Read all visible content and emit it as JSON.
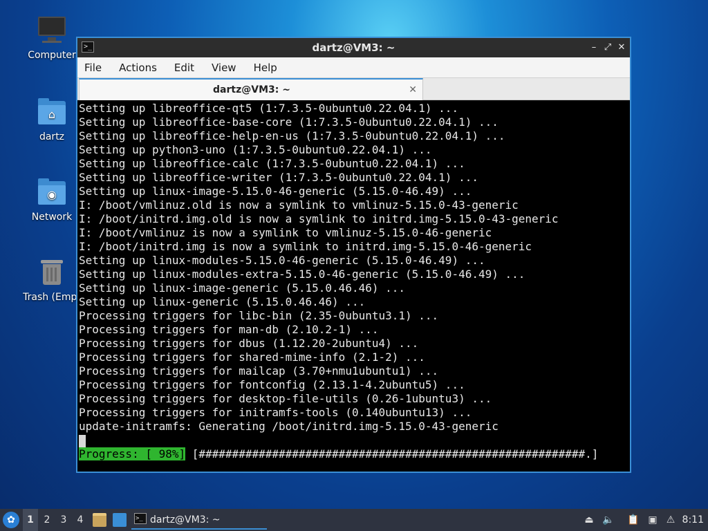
{
  "desktop": {
    "icons": [
      {
        "label": "Computer"
      },
      {
        "label": "dartz"
      },
      {
        "label": "Network"
      },
      {
        "label": "Trash (Empt"
      }
    ]
  },
  "window": {
    "title": "dartz@VM3: ~",
    "menu": [
      "File",
      "Actions",
      "Edit",
      "View",
      "Help"
    ],
    "tab_label": "dartz@VM3: ~",
    "terminal_lines": [
      "Setting up libreoffice-qt5 (1:7.3.5-0ubuntu0.22.04.1) ...",
      "Setting up libreoffice-base-core (1:7.3.5-0ubuntu0.22.04.1) ...",
      "Setting up libreoffice-help-en-us (1:7.3.5-0ubuntu0.22.04.1) ...",
      "Setting up python3-uno (1:7.3.5-0ubuntu0.22.04.1) ...",
      "Setting up libreoffice-calc (1:7.3.5-0ubuntu0.22.04.1) ...",
      "Setting up libreoffice-writer (1:7.3.5-0ubuntu0.22.04.1) ...",
      "Setting up linux-image-5.15.0-46-generic (5.15.0-46.49) ...",
      "I: /boot/vmlinuz.old is now a symlink to vmlinuz-5.15.0-43-generic",
      "I: /boot/initrd.img.old is now a symlink to initrd.img-5.15.0-43-generic",
      "I: /boot/vmlinuz is now a symlink to vmlinuz-5.15.0-46-generic",
      "I: /boot/initrd.img is now a symlink to initrd.img-5.15.0-46-generic",
      "Setting up linux-modules-5.15.0-46-generic (5.15.0-46.49) ...",
      "Setting up linux-modules-extra-5.15.0-46-generic (5.15.0-46.49) ...",
      "Setting up linux-image-generic (5.15.0.46.46) ...",
      "Setting up linux-generic (5.15.0.46.46) ...",
      "Processing triggers for libc-bin (2.35-0ubuntu3.1) ...",
      "Processing triggers for man-db (2.10.2-1) ...",
      "Processing triggers for dbus (1.12.20-2ubuntu4) ...",
      "Processing triggers for shared-mime-info (2.1-2) ...",
      "Processing triggers for mailcap (3.70+nmu1ubuntu1) ...",
      "Processing triggers for fontconfig (2.13.1-4.2ubuntu5) ...",
      "Processing triggers for desktop-file-utils (0.26-1ubuntu3) ...",
      "Processing triggers for initramfs-tools (0.140ubuntu13) ...",
      "update-initramfs: Generating /boot/initrd.img-5.15.0-43-generic"
    ],
    "progress_label": "Progress: [ 98%]",
    "progress_bar": " [##########################################################.]",
    "progress_percent": 98
  },
  "taskbar": {
    "workspaces": [
      "1",
      "2",
      "3",
      "4"
    ],
    "active_workspace": "1",
    "task_label": "dartz@VM3: ~",
    "clock": "8:11"
  },
  "colors": {
    "accent": "#3a8fd6",
    "progress_green": "#2fb52f",
    "terminal_bg": "#000000",
    "terminal_fg": "#e8e8e8"
  }
}
